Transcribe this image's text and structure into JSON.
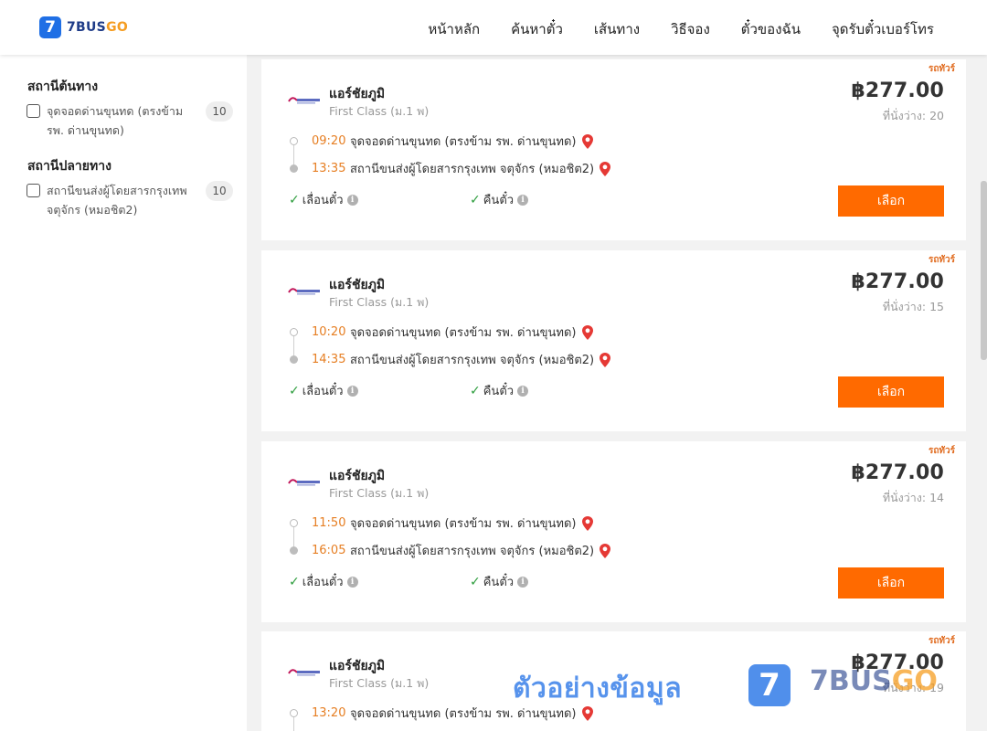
{
  "brand": {
    "logo_mark": "7",
    "name_main": "7BUS",
    "name_accent": "GO"
  },
  "nav": {
    "items": [
      {
        "label": "หน้าหลัก"
      },
      {
        "label": "ค้นหาตั๋ว"
      },
      {
        "label": "เส้นทาง"
      },
      {
        "label": "วิธีจอง"
      },
      {
        "label": "ตั๋วของฉัน"
      },
      {
        "label": "จุดรับตั๋วเบอร์โทร"
      }
    ]
  },
  "filters": {
    "origin": {
      "title": "สถานีต้นทาง",
      "options": [
        {
          "label": "จุดจอดด่านขุนทด (ตรงข้าม รพ. ด่านขุนทด)",
          "count": "10"
        }
      ]
    },
    "destination": {
      "title": "สถานีปลายทาง",
      "options": [
        {
          "label": "สถานีขนส่งผู้โดยสารกรุงเทพ จตุจักร (หมอชิต2)",
          "count": "10"
        }
      ]
    }
  },
  "trips": [
    {
      "tag": "รถทัวร์",
      "operator": "แอร์ชัยภูมิ",
      "class": "First Class (ม.1 พ)",
      "price": "฿277.00",
      "seats": "ที่นั่งว่าง: 20",
      "depart_time": "09:20",
      "depart_place": "จุดจอดด่านขุนทด (ตรงข้าม รพ. ด่านขุนทด)",
      "arrive_time": "13:35",
      "arrive_place": "สถานีขนส่งผู้โดยสารกรุงเทพ จตุจักร (หมอชิต2)",
      "feature_1": "เลื่อนตั๋ว",
      "feature_2": "คืนตั๋ว",
      "button": "เลือก"
    },
    {
      "tag": "รถทัวร์",
      "operator": "แอร์ชัยภูมิ",
      "class": "First Class (ม.1 พ)",
      "price": "฿277.00",
      "seats": "ที่นั่งว่าง: 15",
      "depart_time": "10:20",
      "depart_place": "จุดจอดด่านขุนทด (ตรงข้าม รพ. ด่านขุนทด)",
      "arrive_time": "14:35",
      "arrive_place": "สถานีขนส่งผู้โดยสารกรุงเทพ จตุจักร (หมอชิต2)",
      "feature_1": "เลื่อนตั๋ว",
      "feature_2": "คืนตั๋ว",
      "button": "เลือก"
    },
    {
      "tag": "รถทัวร์",
      "operator": "แอร์ชัยภูมิ",
      "class": "First Class (ม.1 พ)",
      "price": "฿277.00",
      "seats": "ที่นั่งว่าง: 14",
      "depart_time": "11:50",
      "depart_place": "จุดจอดด่านขุนทด (ตรงข้าม รพ. ด่านขุนทด)",
      "arrive_time": "16:05",
      "arrive_place": "สถานีขนส่งผู้โดยสารกรุงเทพ จตุจักร (หมอชิต2)",
      "feature_1": "เลื่อนตั๋ว",
      "feature_2": "คืนตั๋ว",
      "button": "เลือก"
    },
    {
      "tag": "รถทัวร์",
      "operator": "แอร์ชัยภูมิ",
      "class": "First Class (ม.1 พ)",
      "price": "฿277.00",
      "seats": "ที่นั่งว่าง: 19",
      "depart_time": "13:20",
      "depart_place": "จุดจอดด่านขุนทด (ตรงข้าม รพ. ด่านขุนทด)"
    }
  ],
  "watermark": {
    "text": "ตัวอย่างข้อมูล",
    "mark": "7",
    "brand_main": "7BUS",
    "brand_accent": "GO"
  },
  "colors": {
    "accent": "#ff6a00",
    "time": "#e67e22",
    "brand_blue": "#1f6fe5",
    "check": "#2e9d3e",
    "pin": "#e53935"
  },
  "icons": [
    "checkbox-icon",
    "location-pin-icon",
    "check-icon",
    "info-icon",
    "operator-logo-icon"
  ]
}
